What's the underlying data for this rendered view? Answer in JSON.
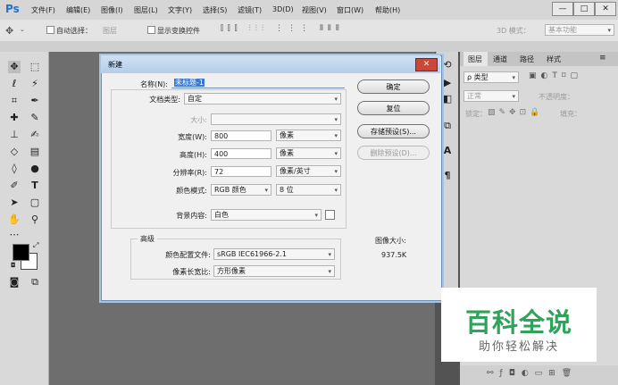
{
  "app": {
    "logo": "Ps"
  },
  "menu": [
    "文件(F)",
    "编辑(E)",
    "图像(I)",
    "图层(L)",
    "文字(Y)",
    "选择(S)",
    "滤镜(T)",
    "3D(D)",
    "视图(V)",
    "窗口(W)",
    "帮助(H)"
  ],
  "window_controls": {
    "minimize": "—",
    "maximize": "□",
    "close": "✕"
  },
  "options_bar": {
    "auto_select_label": "自动选择：",
    "auto_select_value": "图层",
    "show_transform_label": "显示变换控件",
    "mode_3d_label": "3D 模式：",
    "workspace_value": "基本功能"
  },
  "panels": {
    "tabs": [
      "图层",
      "通道",
      "路径",
      "样式"
    ],
    "filter_kind": "ρ 类型",
    "blend_mode": "正常",
    "opacity_label": "不透明度：",
    "lock_label": "锁定：",
    "fill_label": "填充："
  },
  "dialog": {
    "title": "新建",
    "close_glyph": "✕",
    "name_label": "名称(N):",
    "name_value": "未标题-1",
    "doctype_label": "文档类型:",
    "doctype_value": "自定",
    "size_label": "大小:",
    "width_label": "宽度(W):",
    "width_value": "800",
    "width_unit": "像素",
    "height_label": "高度(H):",
    "height_value": "400",
    "height_unit": "像素",
    "resolution_label": "分辨率(R):",
    "resolution_value": "72",
    "resolution_unit": "像素/英寸",
    "colormode_label": "颜色模式:",
    "colormode_value": "RGB 颜色",
    "bitdepth_value": "8 位",
    "background_label": "背景内容:",
    "background_value": "白色",
    "advanced_title": "高级",
    "colorprofile_label": "颜色配置文件:",
    "colorprofile_value": "sRGB IEC61966-2.1",
    "pixelaspect_label": "像素长宽比:",
    "pixelaspect_value": "方形像素",
    "buttons": {
      "ok": "确定",
      "reset": "复位",
      "save_preset": "存储预设(S)...",
      "delete_preset": "删除预设(D)..."
    },
    "image_size_label": "图像大小:",
    "image_size_value": "937.5K"
  },
  "watermark": {
    "title": "百科全说",
    "subtitle": "助你轻松解决"
  },
  "colors": {
    "accent": "#2fa35a",
    "dialog_border": "#6c8fb5",
    "close_red": "#c9483a"
  }
}
